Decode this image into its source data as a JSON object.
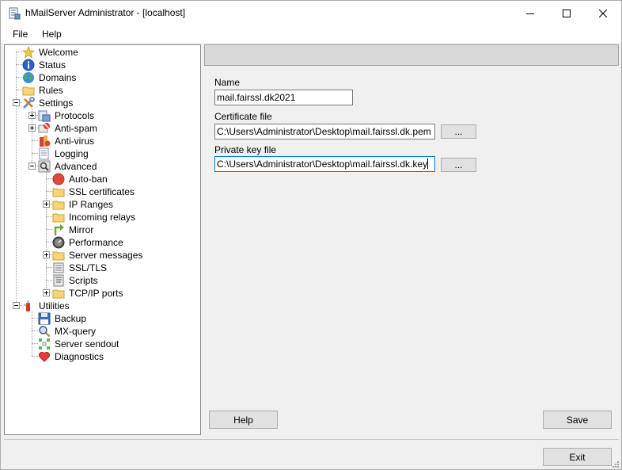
{
  "window": {
    "title": "hMailServer Administrator - [localhost]"
  },
  "menu": {
    "file": "File",
    "help": "Help"
  },
  "tree": {
    "welcome": "Welcome",
    "status": "Status",
    "domains": "Domains",
    "rules": "Rules",
    "settings": "Settings",
    "protocols": "Protocols",
    "antispam": "Anti-spam",
    "antivirus": "Anti-virus",
    "logging": "Logging",
    "advanced": "Advanced",
    "autoban": "Auto-ban",
    "ssl_certificates": "SSL certificates",
    "ip_ranges": "IP Ranges",
    "incoming_relays": "Incoming relays",
    "mirror": "Mirror",
    "performance": "Performance",
    "server_messages": "Server messages",
    "ssl_tls": "SSL/TLS",
    "scripts": "Scripts",
    "tcpip_ports": "TCP/IP ports",
    "utilities": "Utilities",
    "backup": "Backup",
    "mx_query": "MX-query",
    "server_sendout": "Server sendout",
    "diagnostics": "Diagnostics"
  },
  "form": {
    "name_label": "Name",
    "name_value": "mail.fairssl.dk2021",
    "certificate_label": "Certificate file",
    "certificate_value": "C:\\Users\\Administrator\\Desktop\\mail.fairssl.dk.pem",
    "browse_label": "...",
    "private_key_label": "Private key file",
    "private_key_value": "C:\\Users\\Administrator\\Desktop\\mail.fairssl.dk.key"
  },
  "buttons": {
    "help": "Help",
    "save": "Save",
    "exit": "Exit"
  }
}
